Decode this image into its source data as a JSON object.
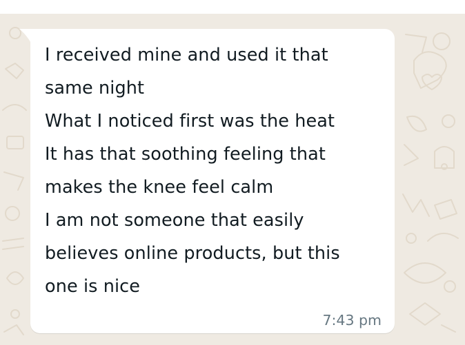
{
  "colors": {
    "wallpaper": "#efeae2",
    "bubble_background": "#ffffff",
    "message_text": "#111b21",
    "timestamp_text": "#667781"
  },
  "icons": [
    "doodle-wallpaper-pattern",
    "bubble-tail"
  ],
  "message": {
    "lines": [
      "I received mine and used it that",
      "same night",
      "What I noticed first was the heat",
      "It has that soothing feeling that",
      "makes the knee feel calm",
      "I am not someone that easily",
      "believes online products, but this",
      "one is nice"
    ],
    "timestamp": "7:43 pm"
  }
}
